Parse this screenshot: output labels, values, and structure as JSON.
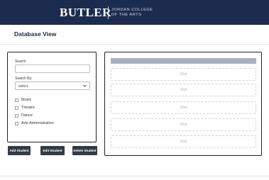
{
  "header": {
    "brand": "BUTLER",
    "subtitle_line1": "JORDAN COLLEGE",
    "subtitle_line2": "of the ARTS"
  },
  "page": {
    "title": "Database View"
  },
  "filters": {
    "search_label": "Search",
    "search_value": "",
    "search_by_label": "Search By:",
    "search_by_value": "select",
    "options": [
      {
        "label": "Music",
        "checked": false
      },
      {
        "label": "Theatre",
        "checked": false
      },
      {
        "label": "Dance",
        "checked": false
      },
      {
        "label": "Arts Administration",
        "checked": false
      }
    ]
  },
  "actions": {
    "add": "Add Student",
    "edit": "Edit Student",
    "delete": "Delete Student"
  },
  "results": {
    "slots": [
      "Slot",
      "Slot",
      "Slot",
      "Slot",
      "Slot"
    ]
  },
  "colors": {
    "header_bg": "#1c2c4f",
    "button_bg": "#353b44",
    "slot_header_bar": "#a9b0bd"
  }
}
